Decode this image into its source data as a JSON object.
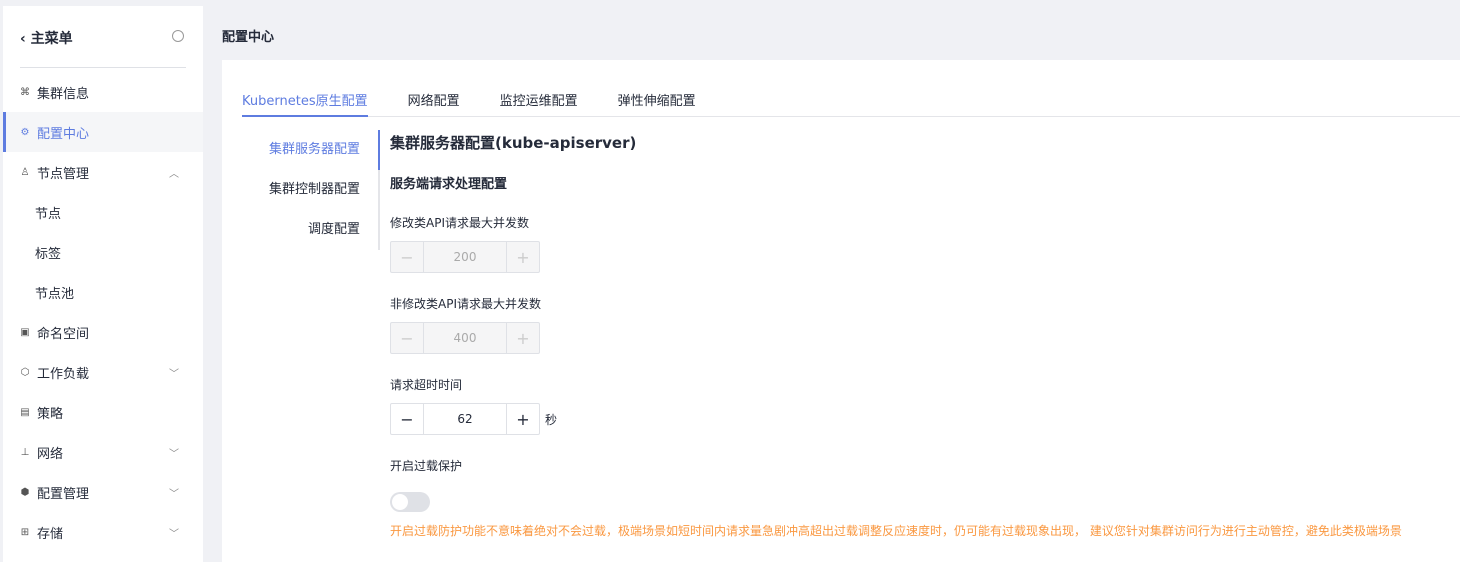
{
  "sidebar": {
    "title": "主菜单",
    "items": [
      {
        "label": "集群信息",
        "icon": "cluster-icon"
      },
      {
        "label": "配置中心",
        "icon": "config-icon",
        "active": true
      },
      {
        "label": "节点管理",
        "icon": "node-icon",
        "expanded": true
      },
      {
        "label": "节点"
      },
      {
        "label": "标签"
      },
      {
        "label": "节点池"
      },
      {
        "label": "命名空间",
        "icon": "namespace-icon"
      },
      {
        "label": "工作负载",
        "icon": "workload-icon"
      },
      {
        "label": "策略",
        "icon": "policy-icon"
      },
      {
        "label": "网络",
        "icon": "network-icon"
      },
      {
        "label": "配置管理",
        "icon": "config-manage-icon"
      },
      {
        "label": "存储",
        "icon": "storage-icon"
      }
    ]
  },
  "page_title": "配置中心",
  "tabs": [
    "Kubernetes原生配置",
    "网络配置",
    "监控运维配置",
    "弹性伸缩配置"
  ],
  "subnav": [
    "集群服务器配置",
    "集群控制器配置",
    "调度配置"
  ],
  "content": {
    "title": "集群服务器配置(kube-apiserver)",
    "section": "服务端请求处理配置",
    "f1_label": "修改类API请求最大并发数",
    "f1_value": "200",
    "f2_label": "非修改类API请求最大并发数",
    "f2_value": "400",
    "f3_label": "请求超时时间",
    "f3_value": "62",
    "f3_unit": "秒",
    "f4_label": "开启过载保护",
    "f4_on": false,
    "warning": "开启过载防护功能不意味着绝对不会过载，极端场景如短时间内请求量急剧冲高超出过载调整反应速度时，仍可能有过载现象出现， 建议您针对集群访问行为进行主动管控，避免此类极端场景"
  },
  "accent": "#5e7ce0",
  "warn_color": "#fa9841"
}
